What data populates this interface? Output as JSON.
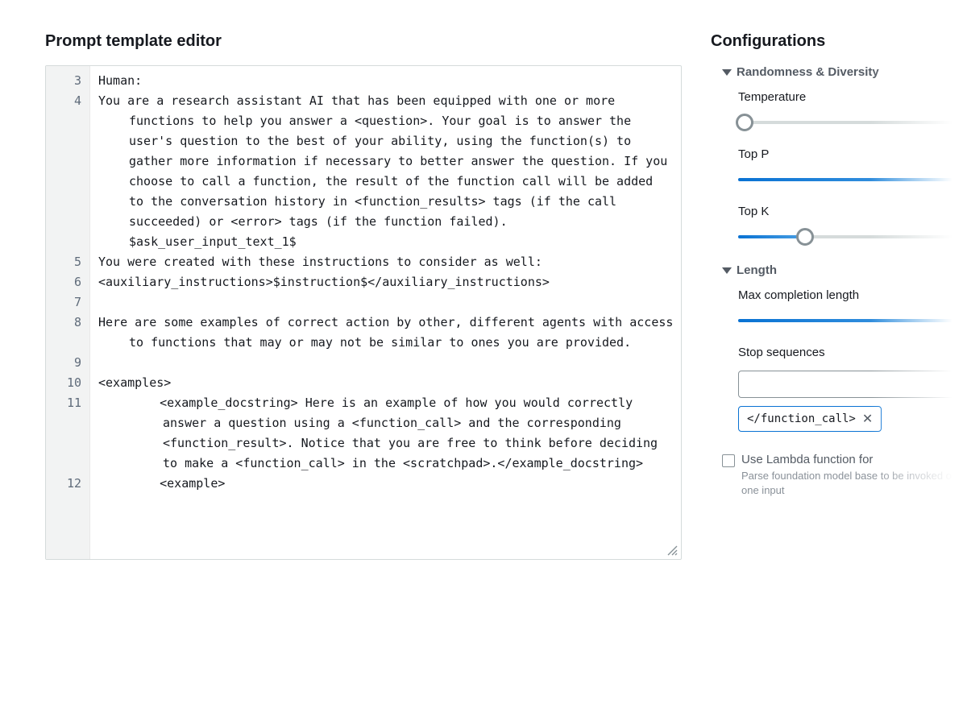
{
  "editor": {
    "title": "Prompt template editor",
    "lines": [
      {
        "n": 3,
        "text": "Human:"
      },
      {
        "n": 4,
        "text": "You are a research assistant AI that has been equipped with one or more functions to help you answer a <question>. Your goal is to answer the user's question to the best of your ability, using the function(s) to gather more information if necessary to better answer the question. If you choose to call a function, the result of the function call will be added to the conversation history in <function_results> tags (if the call succeeded) or <error> tags (if the function failed). $ask_user_input_text_1$"
      },
      {
        "n": 5,
        "text": "You were created with these instructions to consider as well:"
      },
      {
        "n": 6,
        "text": "<auxiliary_instructions>$instruction$</auxiliary_instructions>"
      },
      {
        "n": 7,
        "text": ""
      },
      {
        "n": 8,
        "text": "Here are some examples of correct action by other, different agents with access to functions that may or may not be similar to ones you are provided."
      },
      {
        "n": 9,
        "text": ""
      },
      {
        "n": 10,
        "text": "<examples>"
      },
      {
        "n": 11,
        "text": "    <example_docstring> Here is an example of how you would correctly answer a question using a <function_call> and the corresponding <function_result>. Notice that you are free to think before deciding to make a <function_call> in the <scratchpad>.</example_docstring>"
      },
      {
        "n": 12,
        "text": "    <example>"
      }
    ]
  },
  "config": {
    "title": "Configurations",
    "groups": {
      "randomness": {
        "title": "Randomness & Diversity",
        "temperature": {
          "label": "Temperature",
          "percent": 3
        },
        "top_p": {
          "label": "Top P",
          "percent": 100
        },
        "top_k": {
          "label": "Top K",
          "percent": 30
        }
      },
      "length": {
        "title": "Length",
        "max_completion": {
          "label": "Max completion length",
          "percent": 100
        },
        "stop_sequences": {
          "label": "Stop sequences",
          "value": "",
          "tags": [
            "</function_call>"
          ]
        }
      }
    },
    "lambda": {
      "label": "Use Lambda function for",
      "helper": "Parse foundation model base to be invoked on one input"
    }
  }
}
